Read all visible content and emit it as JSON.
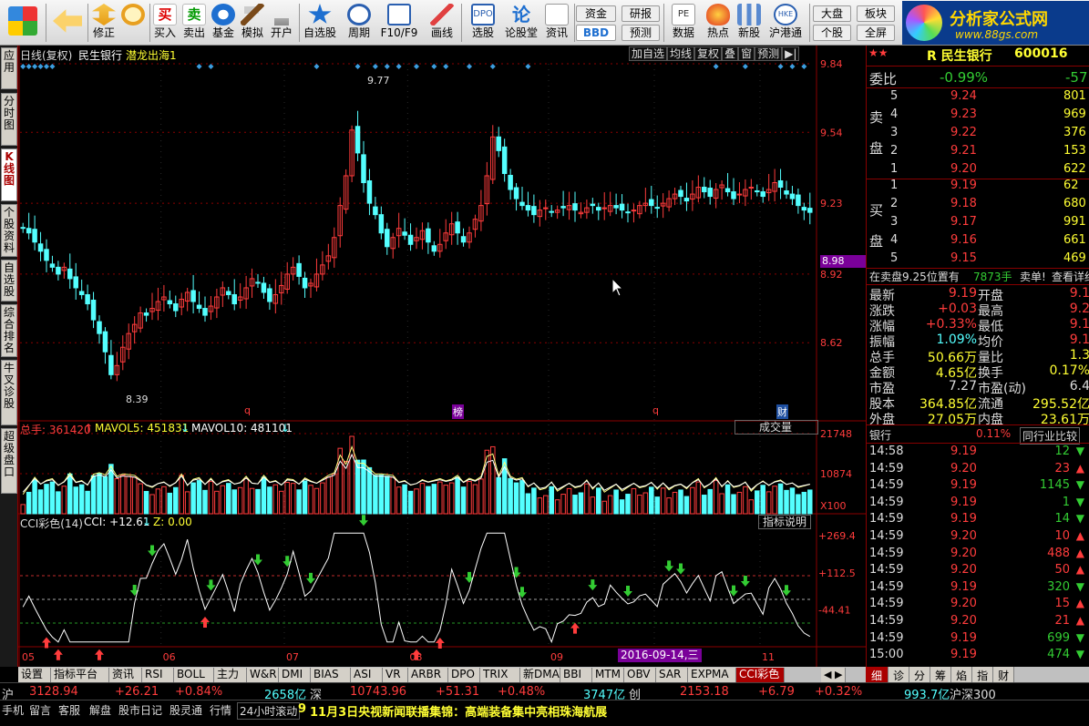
{
  "toolbar": {
    "buttons": [
      {
        "label": "",
        "icon": "windows-logo-icon"
      },
      {
        "label": "",
        "icon": "back-arrow-icon"
      },
      {
        "label": "修正",
        "icon": "up-down-arrows-icon"
      },
      {
        "label": "",
        "icon": "power-icon"
      },
      {
        "label": "买入",
        "icon": "buy-icon"
      },
      {
        "label": "卖出",
        "icon": "sell-icon"
      },
      {
        "label": "基金",
        "icon": "fund-icon"
      },
      {
        "label": "模拟",
        "icon": "hammer-icon"
      },
      {
        "label": "开户",
        "icon": "lock-icon"
      },
      {
        "label": "自选股",
        "icon": "star-icon"
      },
      {
        "label": "周期",
        "icon": "clock-icon"
      },
      {
        "label": "F10/F9",
        "icon": "f10-icon"
      },
      {
        "label": "画线",
        "icon": "pencil-icon"
      },
      {
        "label": "选股",
        "icon": "select-stock-icon"
      },
      {
        "label": "论股堂",
        "icon": "forum-icon"
      },
      {
        "label": "资讯",
        "icon": "news-icon"
      },
      {
        "label": "数据",
        "icon": "pe-data-icon"
      },
      {
        "label": "热点",
        "icon": "hot-icon"
      },
      {
        "label": "新股",
        "icon": "new-stock-icon"
      },
      {
        "label": "沪港通",
        "icon": "hkex-icon"
      }
    ],
    "small": {
      "zijin": "资金",
      "bbd": "BBD",
      "yanbao": "研报",
      "yuce": "预测",
      "dapan": "大盘",
      "bankuai": "板块",
      "gegu": "个股",
      "quanping": "全屏"
    },
    "brand": "分析家公式网",
    "brand_url": "www.88gs.com"
  },
  "left_tabs": [
    "应用",
    "分时图",
    "K线图",
    "个股资料",
    "自选股",
    "综合排名",
    "牛叉诊股",
    "超级盘口"
  ],
  "chart_header": {
    "period": "日线(复权)",
    "name": "民生银行",
    "formula": "潜龙出海1"
  },
  "chart_buttons": [
    "加自选",
    "均线",
    "复权",
    "叠",
    "窗",
    "预测",
    "▶|"
  ],
  "markers": {
    "q1": "q",
    "bang": "榜",
    "q2": "q",
    "cai": "财"
  },
  "volume_header": {
    "total": "总手: 361420",
    "total_arrow": "↑",
    "ma5": "MAVOL5: 451831",
    "ma5_arrow": "↓",
    "ma10": "MAVOL10: 481101",
    "ma10_arrow": "↓",
    "dropdown": "成交量",
    "x100": "X100"
  },
  "cci_header": {
    "name": "CCI彩色(14)",
    "cci": "CCI: +12.61",
    "cci_arrow": "↓",
    "z": "Z: 0.00",
    "help": "指标说明"
  },
  "date_cursor": "2016-09-14,三",
  "colors": {
    "up": "#ff3c3c",
    "down": "#54ffff",
    "grid": "#8b0000",
    "bg": "#000000",
    "purple": "#7a0099",
    "yellow": "#ffff33"
  },
  "chart_data": [
    {
      "type": "candlestick",
      "title": "民生银行 日线(复权)",
      "x_labels": [
        "05",
        "06",
        "07",
        "08",
        "09",
        "10",
        "11"
      ],
      "y_ticks": [
        9.84,
        9.54,
        9.23,
        8.92,
        8.62
      ],
      "ylim": [
        8.31,
        9.84
      ],
      "current_price_tag": 8.98,
      "annotations": [
        {
          "label": "9.77",
          "type": "high"
        },
        {
          "label": "8.39",
          "type": "low"
        }
      ],
      "closes": [
        9.12,
        9.1,
        9.06,
        9.02,
        8.98,
        8.95,
        8.92,
        8.95,
        8.9,
        8.86,
        8.83,
        8.79,
        8.72,
        8.66,
        8.58,
        8.48,
        8.52,
        8.6,
        8.66,
        8.7,
        8.75,
        8.74,
        8.77,
        8.8,
        8.82,
        8.79,
        8.76,
        8.81,
        8.84,
        8.8,
        8.77,
        8.74,
        8.78,
        8.82,
        8.86,
        8.83,
        8.79,
        8.82,
        8.86,
        8.9,
        8.88,
        8.84,
        8.8,
        8.83,
        8.87,
        8.92,
        8.95,
        8.91,
        8.86,
        8.88,
        8.92,
        8.96,
        9.0,
        9.08,
        9.22,
        9.35,
        9.55,
        9.45,
        9.32,
        9.23,
        9.18,
        9.1,
        9.04,
        9.08,
        9.12,
        9.09,
        9.05,
        9.08,
        9.11,
        9.06,
        9.02,
        9.05,
        9.1,
        9.14,
        9.1,
        9.06,
        9.1,
        9.16,
        9.22,
        9.35,
        9.52,
        9.46,
        9.36,
        9.29,
        9.25,
        9.22,
        9.2,
        9.18,
        9.2,
        9.21,
        9.19,
        9.2,
        9.21,
        9.22,
        9.2,
        9.19,
        9.21,
        9.22,
        9.2,
        9.21,
        9.22,
        9.21,
        9.2,
        9.19,
        9.2,
        9.22,
        9.23,
        9.22,
        9.21,
        9.23,
        9.25,
        9.27,
        9.26,
        9.24,
        9.27,
        9.3,
        9.28,
        9.26,
        9.29,
        9.31,
        9.28,
        9.25,
        9.27,
        9.29,
        9.3,
        9.28,
        9.26,
        9.29,
        9.32,
        9.3,
        9.27,
        9.25,
        9.22,
        9.2,
        9.19
      ],
      "highs": [
        9.19,
        9.77,
        8.39
      ]
    },
    {
      "type": "bar",
      "title": "成交量",
      "y_ticks": [
        21748,
        10874
      ],
      "units": "X100",
      "ma5": 451831,
      "ma10": 481101,
      "total": 361420
    },
    {
      "type": "line",
      "title": "CCI彩色(14)",
      "y_ticks": [
        269.4,
        112.5,
        -44.41
      ],
      "cci": 12.61,
      "z": 0.0,
      "levels": [
        100,
        0,
        -100
      ]
    }
  ],
  "stock": {
    "name": "R 民生银行",
    "code": "600016"
  },
  "weibi": {
    "label": "委比",
    "value": "-0.99%",
    "extra": "-57"
  },
  "sell": {
    "label1": "卖",
    "label2": "盘",
    "rows": [
      [
        "5",
        "9.24",
        "801"
      ],
      [
        "4",
        "9.23",
        "969"
      ],
      [
        "3",
        "9.22",
        "376"
      ],
      [
        "2",
        "9.21",
        "153"
      ],
      [
        "1",
        "9.20",
        "622"
      ]
    ]
  },
  "buy": {
    "label1": "买",
    "label2": "盘",
    "rows": [
      [
        "1",
        "9.19",
        "62"
      ],
      [
        "2",
        "9.18",
        "680"
      ],
      [
        "3",
        "9.17",
        "991"
      ],
      [
        "4",
        "9.16",
        "661"
      ],
      [
        "5",
        "9.15",
        "469"
      ]
    ]
  },
  "sell_notice": {
    "text": "在卖盘9.25位置有",
    "qty": "7873手",
    "tag": "卖单!",
    "link": "查看详细"
  },
  "quote": [
    [
      "最新",
      "9.19",
      "开盘",
      "9.1"
    ],
    [
      "涨跌",
      "+0.03",
      "最高",
      "9.2"
    ],
    [
      "涨幅",
      "+0.33%",
      "最低",
      "9.1"
    ],
    [
      "振幅",
      "1.09%",
      "均价",
      "9.1"
    ],
    [
      "总手",
      "50.66万",
      "量比",
      "1.3"
    ],
    [
      "金额",
      "4.65亿",
      "换手",
      "0.17%"
    ],
    [
      "市盈",
      "7.27",
      "市盈(动)",
      "6.4"
    ],
    [
      "股本",
      "364.85亿",
      "流通",
      "295.52亿"
    ],
    [
      "外盘",
      "27.05万",
      "内盘",
      "23.61万"
    ]
  ],
  "industry": {
    "name": "银行",
    "change": "0.11%",
    "compare": "同行业比较"
  },
  "ticks": [
    [
      "14:58",
      "9.19",
      "12"
    ],
    [
      "14:59",
      "9.20",
      "23"
    ],
    [
      "14:59",
      "9.19",
      "1145"
    ],
    [
      "14:59",
      "9.19",
      "1"
    ],
    [
      "14:59",
      "9.19",
      "14"
    ],
    [
      "14:59",
      "9.20",
      "10"
    ],
    [
      "14:59",
      "9.20",
      "488"
    ],
    [
      "14:59",
      "9.20",
      "50"
    ],
    [
      "14:59",
      "9.19",
      "320"
    ],
    [
      "14:59",
      "9.20",
      "15"
    ],
    [
      "14:59",
      "9.20",
      "21"
    ],
    [
      "14:59",
      "9.19",
      "699"
    ],
    [
      "15:00",
      "9.19",
      "474"
    ]
  ],
  "right_tabs": [
    "细",
    "诊",
    "分",
    "筹",
    "焰",
    "指",
    "财"
  ],
  "bottom_tabs": [
    "设置",
    "指标平台",
    "资讯",
    "RSI",
    "BOLL",
    "主力",
    "W&R",
    "DMI",
    "BIAS",
    "ASI",
    "VR",
    "ARBR",
    "DPO",
    "TRIX",
    "新DMA",
    "BBI",
    "MTM",
    "OBV",
    "SAR",
    "EXPMA",
    "CCI彩色"
  ],
  "status": {
    "sh_label": "沪",
    "sh_index": "3128.94",
    "sh_chg": "+26.21",
    "sh_pct": "+0.84%",
    "sh_amt": "2658亿",
    "sz_label": "深",
    "sz_index": "10743.96",
    "sz_chg": "+51.31",
    "sz_pct": "+0.48%",
    "sz_amt": "3747亿",
    "cy_label": "创",
    "cy_index": "2153.18",
    "cy_chg": "+6.79",
    "cy_pct": "+0.32%",
    "hs_amt": "993.7亿",
    "hs_label": "沪深300"
  },
  "status2": {
    "items": [
      "手机",
      "留言",
      "客服",
      "解盘",
      "股市日记",
      "股灵通",
      "行情",
      "24小时滚动"
    ],
    "news_no": "9",
    "news": "11月3日央视新闻联播集锦：高端装备集中亮相珠海航展"
  }
}
